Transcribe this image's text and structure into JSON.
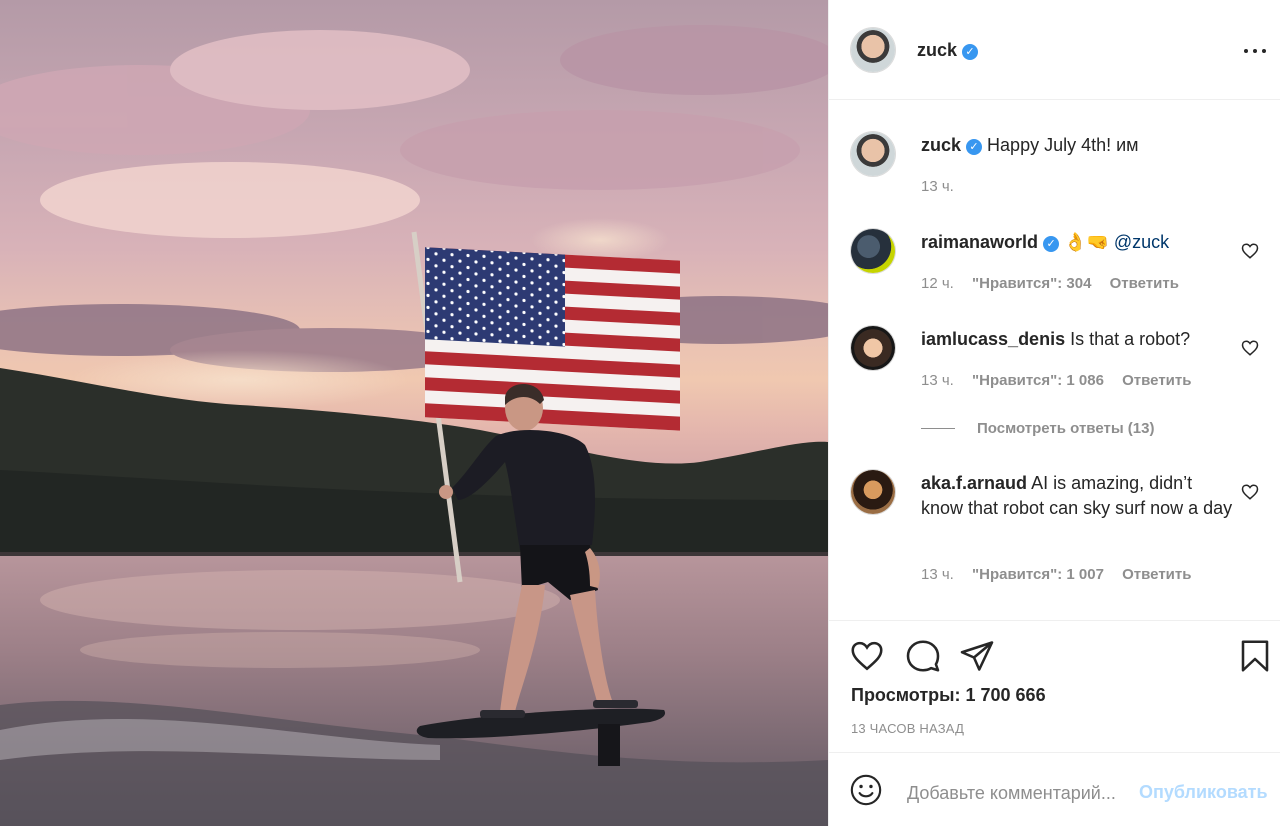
{
  "post": {
    "author": "zuck",
    "caption": "Happy July 4th! им",
    "caption_time": "13 ч.",
    "views_label": "Просмотры: 1 700 666",
    "posted_ago": "13 ЧАСОВ НАЗАД"
  },
  "comments": [
    {
      "user": "raimanaworld",
      "text": "👌🤜 @zuck",
      "time": "12 ч.",
      "likes": "\"Нравится\": 304",
      "reply": "Ответить"
    },
    {
      "user": "iamlucass_denis",
      "text": "Is that a robot?",
      "time": "13 ч.",
      "likes": "\"Нравится\": 1 086",
      "reply": "Ответить",
      "view_replies": "Посмотреть ответы (13)"
    },
    {
      "user": "aka.f.arnaud",
      "text": "AI is amazing, didn’t know that robot can sky surf now a day",
      "time": "13 ч.",
      "likes": "\"Нравится\": 1 007",
      "reply": "Ответить"
    }
  ],
  "composer": {
    "placeholder": "Добавьте комментарий...",
    "publish_label": "Опубликовать"
  },
  "icons": {
    "verified": "verified-badge-icon",
    "more": "more-options-icon",
    "like": "heart-icon",
    "comment": "comment-bubble-icon",
    "share": "paper-plane-icon",
    "save": "bookmark-icon",
    "emoji": "emoji-smiley-icon"
  },
  "colors": {
    "verified": "#3897f0",
    "publish_disabled": "#b3dbff",
    "muted_text": "#8e8e8e"
  }
}
